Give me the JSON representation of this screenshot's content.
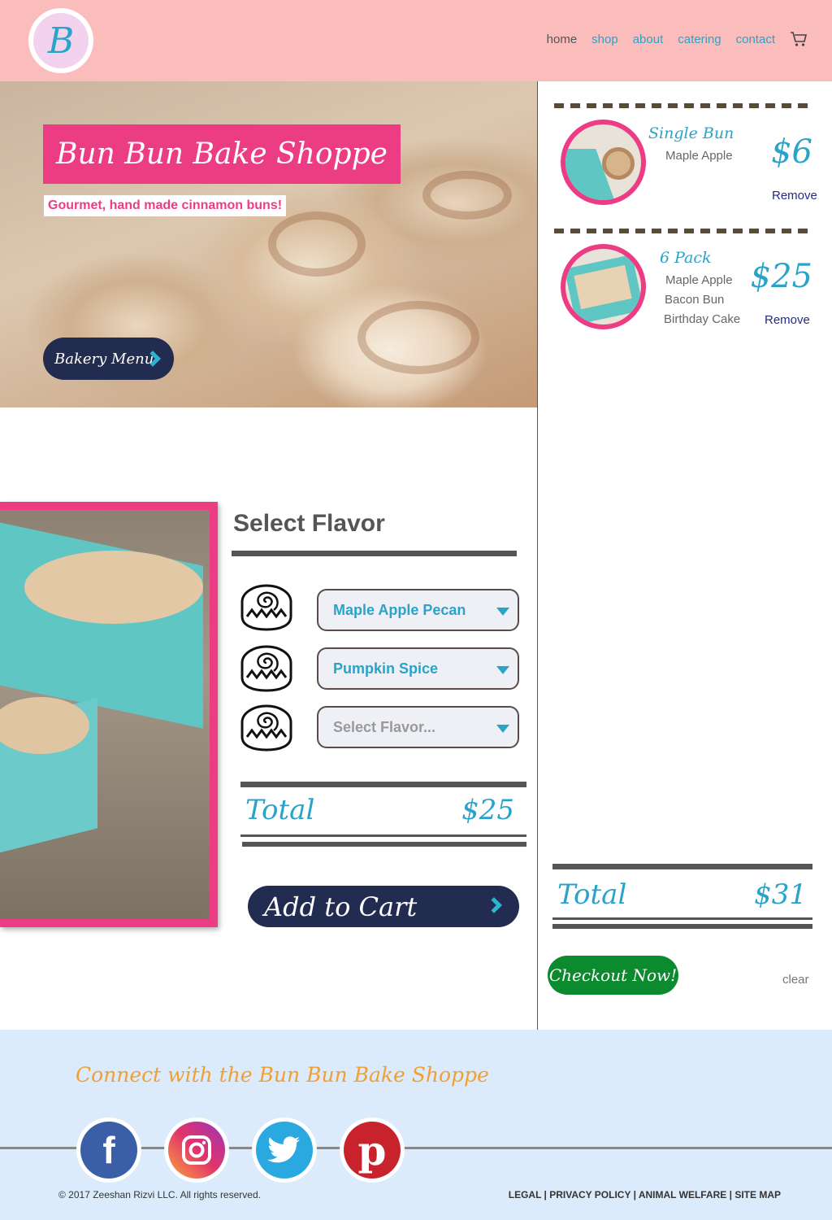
{
  "header": {
    "logo_letter": "B",
    "nav": {
      "home": "home",
      "shop": "shop",
      "about": "about",
      "catering": "catering",
      "contact": "contact"
    }
  },
  "hero": {
    "title": "Bun Bun Bake Shoppe",
    "subtitle": "Gourmet, hand made cinnamon buns!",
    "menu_button": "Bakery Menu"
  },
  "product": {
    "select_title": "Select Flavor",
    "flavors": [
      {
        "value": "Maple Apple Pecan"
      },
      {
        "value": "Pumpkin Spice"
      },
      {
        "value": "Select Flavor..."
      }
    ],
    "total_label": "Total",
    "total_value": "$25",
    "add_to_cart": "Add to Cart"
  },
  "cart": {
    "items": [
      {
        "name": "Single Bun",
        "flavors": [
          "Maple Apple"
        ],
        "price": "$6",
        "remove": "Remove"
      },
      {
        "name": "6 Pack",
        "flavors": [
          "Maple Apple",
          "Bacon Bun",
          "Birthday Cake"
        ],
        "price": "$25",
        "remove": "Remove"
      }
    ],
    "total_label": "Total",
    "total_value": "$31",
    "checkout": "Checkout Now!",
    "clear": "clear"
  },
  "footer": {
    "connect": "Connect with the Bun Bun Bake Shoppe",
    "copyright": "© 2017 Zeeshan Rizvi LLC. All rights reserved.",
    "links": [
      "LEGAL",
      "PRIVACY POLICY",
      "ANIMAL WELFARE",
      "SITE MAP"
    ],
    "social_icons": [
      "facebook-icon",
      "instagram-icon",
      "twitter-icon",
      "pinterest-icon"
    ]
  },
  "colors": {
    "header_bg": "#fbbcbc",
    "accent_pink": "#ec3c84",
    "accent_blue": "#2aa3c9",
    "navy": "#222c50",
    "checkout_green": "#0c8a2e",
    "footer_bg": "#dcebfb",
    "footer_heading": "#f0a030"
  }
}
